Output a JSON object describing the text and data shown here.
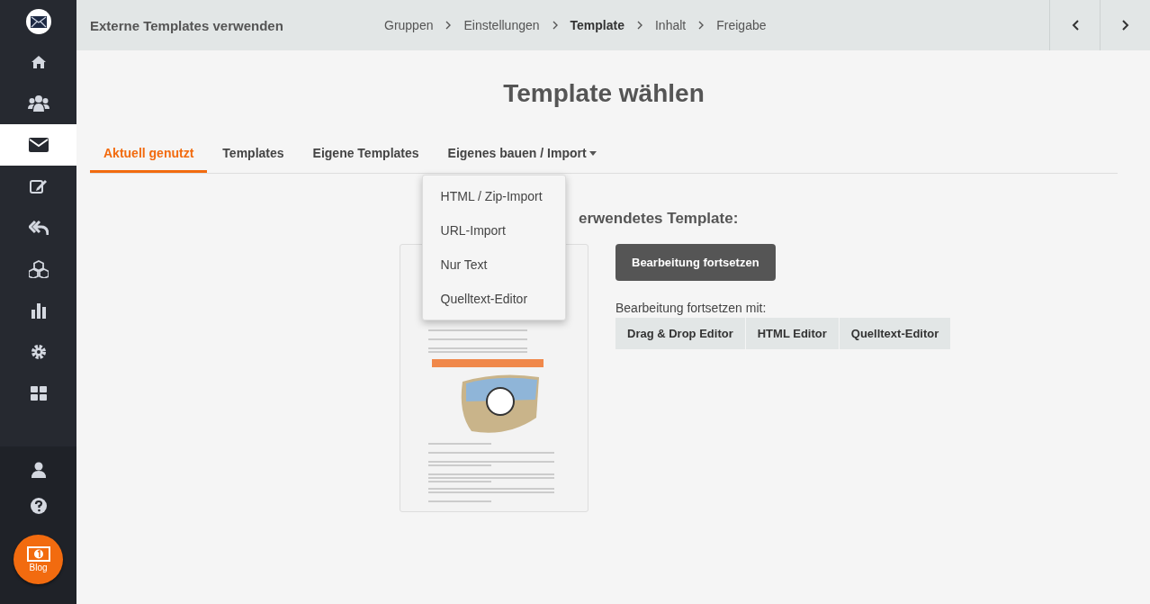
{
  "sidebar": {
    "items": [
      {
        "selected": false
      },
      {
        "selected": false
      },
      {
        "selected": true
      },
      {
        "selected": false
      },
      {
        "selected": false
      },
      {
        "selected": false
      },
      {
        "selected": false
      },
      {
        "selected": false
      },
      {
        "selected": false
      }
    ],
    "blog_button": {
      "label": "Blog"
    }
  },
  "header": {
    "title": "Externe Templates verwenden",
    "steps": [
      {
        "label": "Gruppen",
        "selected": false
      },
      {
        "label": "Einstellungen",
        "selected": false
      },
      {
        "label": "Template",
        "selected": true
      },
      {
        "label": "Inhalt",
        "selected": false
      },
      {
        "label": "Freigabe",
        "selected": false
      }
    ]
  },
  "page": {
    "heading": "Template wählen",
    "tabs": [
      {
        "label": "Aktuell genutzt",
        "selected": true,
        "dropdown": false
      },
      {
        "label": "Templates",
        "selected": false,
        "dropdown": false
      },
      {
        "label": "Eigene Templates",
        "selected": false,
        "dropdown": false
      },
      {
        "label": "Eigenes bauen / Import",
        "selected": false,
        "dropdown": true
      }
    ],
    "dropdown_menu": [
      "HTML / Zip-Import",
      "URL-Import",
      "Nur Text",
      "Quelltext-Editor"
    ],
    "section_heading": "erwendetes Template:",
    "primary_button": "Bearbeitung fortsetzen",
    "continue_label": "Bearbeitung fortsetzen mit:",
    "editor_buttons": [
      "Drag & Drop Editor",
      "HTML Editor",
      "Quelltext-Editor"
    ]
  }
}
